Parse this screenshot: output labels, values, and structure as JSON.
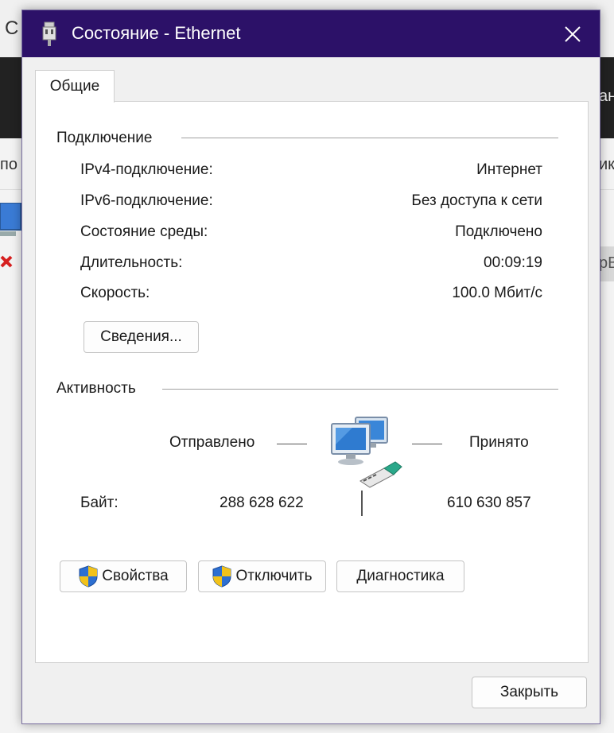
{
  "background": {
    "partial_texts": [
      "С",
      "по",
      "ан",
      "ик",
      "рВ"
    ]
  },
  "dialog": {
    "title": "Состояние - Ethernet",
    "tab": "Общие",
    "connection": {
      "group_title": "Подключение",
      "rows": [
        {
          "label": "IPv4-подключение:",
          "value": "Интернет"
        },
        {
          "label": "IPv6-подключение:",
          "value": "Без доступа к сети"
        },
        {
          "label": "Состояние среды:",
          "value": "Подключено"
        },
        {
          "label": "Длительность:",
          "value": "00:09:19"
        },
        {
          "label": "Скорость:",
          "value": "100.0 Мбит/с"
        }
      ],
      "details_button": "Сведения..."
    },
    "activity": {
      "group_title": "Активность",
      "sent_label": "Отправлено",
      "received_label": "Принято",
      "bytes_label": "Байт:",
      "bytes_sent": "288 628 622",
      "bytes_received": "610 630 857"
    },
    "buttons": {
      "properties": "Свойства",
      "disable": "Отключить",
      "diagnose": "Диагностика",
      "close": "Закрыть"
    }
  },
  "colors": {
    "titlebar": "#2c1168",
    "dialog_bg": "#f0f0f0",
    "panel_bg": "#ffffff"
  }
}
